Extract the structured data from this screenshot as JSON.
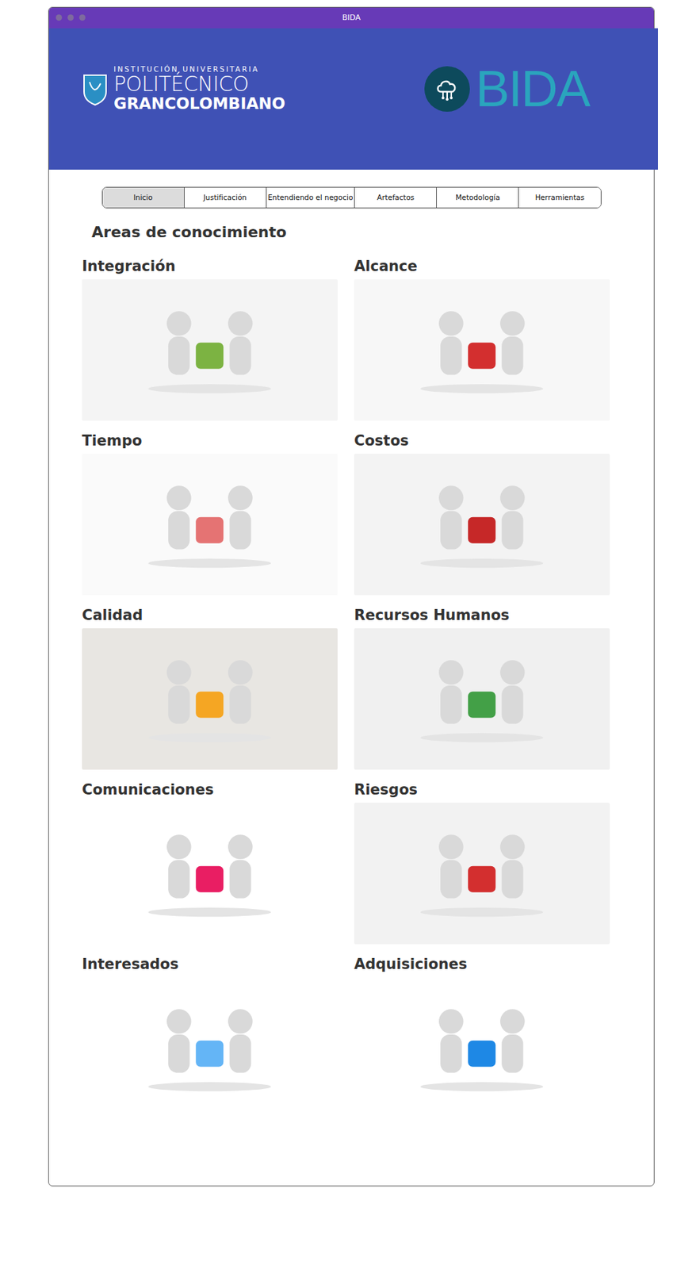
{
  "window": {
    "title": "BIDA"
  },
  "header": {
    "institution": [
      "INSTITUCIÓN UNIVERSITARIA",
      "POLITÉCNICO",
      "GRANCOLOMBIANO"
    ],
    "brand": "BIDA"
  },
  "tabs": [
    {
      "label": "Inicio",
      "selected": true
    },
    {
      "label": "Justificación",
      "selected": false
    },
    {
      "label": "Entendiendo el negocio",
      "selected": false
    },
    {
      "label": "Artefactos",
      "selected": false
    },
    {
      "label": "Metodología",
      "selected": false
    },
    {
      "label": "Herramientas",
      "selected": false
    }
  ],
  "heading": "Areas de conocimiento",
  "areas": [
    "Integración",
    "Alcance",
    "Tiempo",
    "Costos",
    "Calidad",
    "Recursos Humanos",
    "Comunicaciones",
    "Riesgos",
    "Interesados",
    "Adquisiciones"
  ]
}
